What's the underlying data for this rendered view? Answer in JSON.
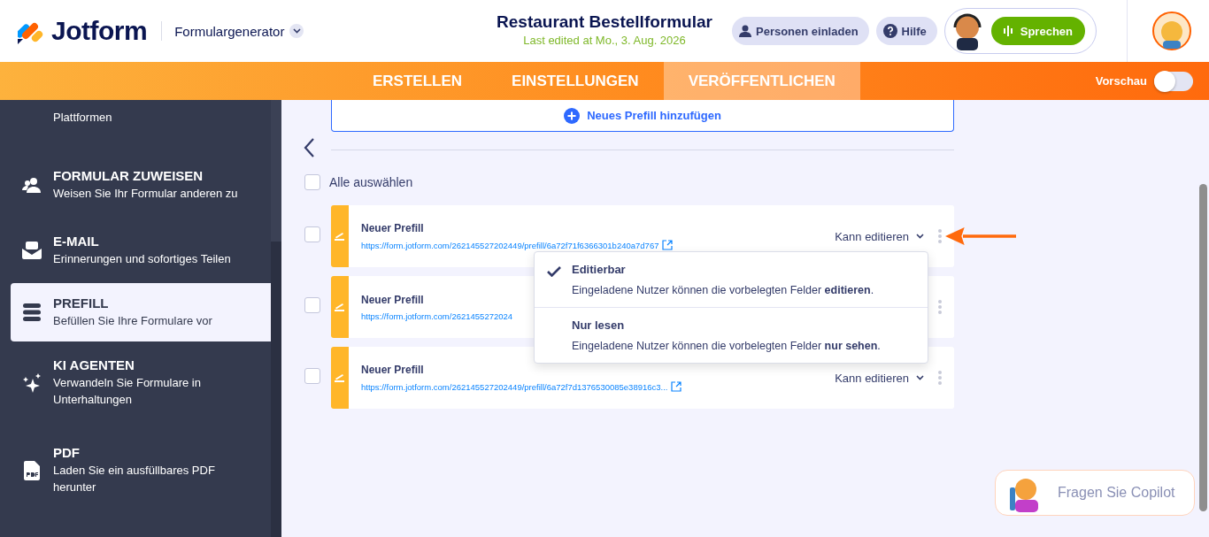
{
  "header": {
    "brand": "Jotform",
    "product": "Formulargenerator",
    "title": "Restaurant Bestellformular",
    "subtitle": "Last edited at Mo., 3. Aug. 2026",
    "buttons": [
      {
        "kind": "invite",
        "label": "Personen einladen"
      },
      {
        "kind": "help",
        "label": "Hilfe"
      }
    ],
    "speak_button": "Sprechen"
  },
  "nav": {
    "tabs": [
      {
        "label": "ERSTELLEN",
        "selected": false
      },
      {
        "label": "EINSTELLUNGEN",
        "selected": false
      },
      {
        "label": "VERÖFFENTLICHEN",
        "selected": true
      }
    ],
    "preview": {
      "label": "Vorschau",
      "on": false
    }
  },
  "sidebar": {
    "items": [
      {
        "kind": "none",
        "description": "Plattformen",
        "selected": false
      },
      {
        "kind": "assign",
        "title": "FORMULAR ZUWEISEN",
        "description": "Weisen Sie Ihr Formular anderen zu",
        "selected": false
      },
      {
        "kind": "email",
        "title": "E-MAIL",
        "description": "Erinnerungen und sofortiges Teilen",
        "selected": false
      },
      {
        "kind": "prefill",
        "title": "PREFILL",
        "description": "Befüllen Sie Ihre Formulare vor",
        "selected": true
      },
      {
        "kind": "ai",
        "title": "KI AGENTEN",
        "description": "Verwandeln Sie Formulare in Unterhaltungen",
        "selected": false
      },
      {
        "kind": "pdf",
        "title": "PDF",
        "description": "Laden Sie ein ausfüllbares PDF herunter",
        "selected": false
      }
    ]
  },
  "main": {
    "add_button": "Neues Prefill hinzufügen",
    "select_all": {
      "label": "Alle auswählen",
      "checked": false
    },
    "prefills": [
      {
        "title": "Neuer Prefill",
        "url": "https://form.jotform.com/262145527202449/prefill/6a72f71f6366301b240a7d767",
        "checked": false,
        "permission": "Kann editieren"
      },
      {
        "title": "Neuer Prefill",
        "url": "https://form.jotform.com/2621455272024",
        "checked": false
      },
      {
        "title": "Neuer Prefill",
        "url": "https://form.jotform.com/262145527202449/prefill/6a72f7d1376530085e38916c3...",
        "checked": false,
        "permission": "Kann editieren"
      }
    ],
    "permission_menu": [
      {
        "title": "Editierbar",
        "description": "Eingeladene Nutzer können die vorbelegten Felder **editieren**.",
        "selected": true
      },
      {
        "title": "Nur lesen",
        "description": "Eingeladene Nutzer können die vorbelegten Felder **nur sehen**.",
        "selected": false
      }
    ]
  },
  "copilot": {
    "placeholder": "Fragen Sie Copilot"
  }
}
